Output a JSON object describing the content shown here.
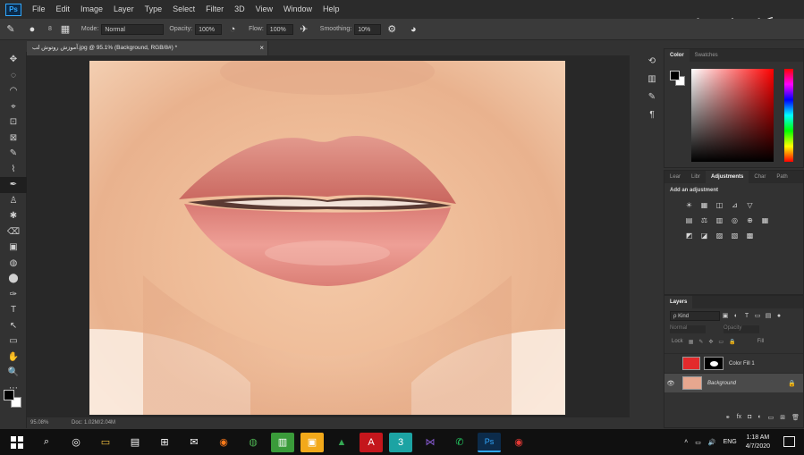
{
  "app": {
    "logo": "Ps"
  },
  "menu": [
    "File",
    "Edit",
    "Image",
    "Layer",
    "Type",
    "Select",
    "Filter",
    "3D",
    "View",
    "Window",
    "Help"
  ],
  "watermark": "خبرگزاری دانشجویان ایران",
  "options": {
    "mode_label": "Mode:",
    "mode_value": "Normal",
    "opacity_label": "Opacity:",
    "opacity_value": "100%",
    "flow_label": "Flow:",
    "flow_value": "100%",
    "smoothing_label": "Smoothing:",
    "smoothing_value": "10%",
    "brush_size": "8"
  },
  "document": {
    "tab_title": "آموزش روتوش لب.jpg @ 95.1% (Background, RGB/8#) *",
    "zoom": "95.08%",
    "doc_info": "Doc: 1.02M/2.04M"
  },
  "tools": [
    "✥",
    "◌",
    "◠",
    "⌖",
    "⊡",
    "⊠",
    "✎",
    "⌇",
    "✒",
    "♙",
    "✱",
    "⌫",
    "▣",
    "◍",
    "⬤",
    "✑",
    "T",
    "↖",
    "▭",
    "✋",
    "🔍",
    "⋯"
  ],
  "color_panel": {
    "tabs": [
      "Color",
      "Swatches"
    ]
  },
  "adjustments_panel": {
    "tabs": [
      "Lear",
      "Libr",
      "Adjustments",
      "Char",
      "Path"
    ],
    "title": "Add an adjustment",
    "rows": [
      [
        "☀",
        "▦",
        "◫",
        "⊿",
        "▽"
      ],
      [
        "▤",
        "⚖",
        "▥",
        "◎",
        "⊕",
        "▦"
      ],
      [
        "◩",
        "◪",
        "▨",
        "▧",
        "▩"
      ]
    ]
  },
  "layers_panel": {
    "tab": "Layers",
    "kind_label": "ρ Kind",
    "blend_mode": "Normal",
    "opacity_label": "Opacity",
    "lock_label": "Lock",
    "fill_label": "Fill",
    "layers": [
      {
        "name": "Color Fill 1",
        "type": "fill",
        "visible": false,
        "selected": false
      },
      {
        "name": "Background",
        "type": "photo",
        "visible": true,
        "selected": true
      }
    ]
  },
  "taskbar": {
    "apps": [
      "⌕",
      "◎",
      "▭",
      "▤",
      "⊞",
      "✉",
      "◉",
      "◍",
      "▥",
      "▣",
      "▲",
      "A",
      "3",
      "⋈",
      "✆",
      "Ps",
      "◉"
    ],
    "language": "ENG",
    "time": "1:18 AM",
    "date": "4/7/2020"
  },
  "colors": {
    "accent": "#31a8ff",
    "fill_layer": "#e32a2c",
    "lip": "#de7a72"
  }
}
